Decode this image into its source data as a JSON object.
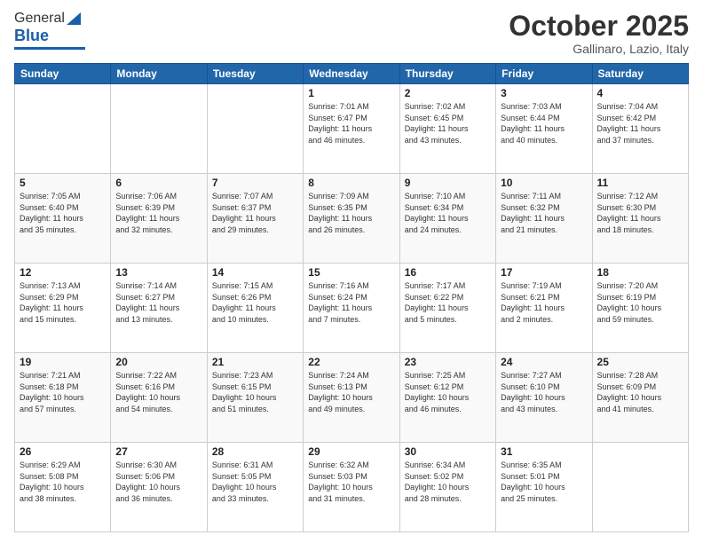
{
  "logo": {
    "general": "General",
    "blue": "Blue"
  },
  "title": {
    "month": "October 2025",
    "location": "Gallinaro, Lazio, Italy"
  },
  "headers": [
    "Sunday",
    "Monday",
    "Tuesday",
    "Wednesday",
    "Thursday",
    "Friday",
    "Saturday"
  ],
  "weeks": [
    [
      {
        "day": "",
        "info": ""
      },
      {
        "day": "",
        "info": ""
      },
      {
        "day": "",
        "info": ""
      },
      {
        "day": "1",
        "info": "Sunrise: 7:01 AM\nSunset: 6:47 PM\nDaylight: 11 hours\nand 46 minutes."
      },
      {
        "day": "2",
        "info": "Sunrise: 7:02 AM\nSunset: 6:45 PM\nDaylight: 11 hours\nand 43 minutes."
      },
      {
        "day": "3",
        "info": "Sunrise: 7:03 AM\nSunset: 6:44 PM\nDaylight: 11 hours\nand 40 minutes."
      },
      {
        "day": "4",
        "info": "Sunrise: 7:04 AM\nSunset: 6:42 PM\nDaylight: 11 hours\nand 37 minutes."
      }
    ],
    [
      {
        "day": "5",
        "info": "Sunrise: 7:05 AM\nSunset: 6:40 PM\nDaylight: 11 hours\nand 35 minutes."
      },
      {
        "day": "6",
        "info": "Sunrise: 7:06 AM\nSunset: 6:39 PM\nDaylight: 11 hours\nand 32 minutes."
      },
      {
        "day": "7",
        "info": "Sunrise: 7:07 AM\nSunset: 6:37 PM\nDaylight: 11 hours\nand 29 minutes."
      },
      {
        "day": "8",
        "info": "Sunrise: 7:09 AM\nSunset: 6:35 PM\nDaylight: 11 hours\nand 26 minutes."
      },
      {
        "day": "9",
        "info": "Sunrise: 7:10 AM\nSunset: 6:34 PM\nDaylight: 11 hours\nand 24 minutes."
      },
      {
        "day": "10",
        "info": "Sunrise: 7:11 AM\nSunset: 6:32 PM\nDaylight: 11 hours\nand 21 minutes."
      },
      {
        "day": "11",
        "info": "Sunrise: 7:12 AM\nSunset: 6:30 PM\nDaylight: 11 hours\nand 18 minutes."
      }
    ],
    [
      {
        "day": "12",
        "info": "Sunrise: 7:13 AM\nSunset: 6:29 PM\nDaylight: 11 hours\nand 15 minutes."
      },
      {
        "day": "13",
        "info": "Sunrise: 7:14 AM\nSunset: 6:27 PM\nDaylight: 11 hours\nand 13 minutes."
      },
      {
        "day": "14",
        "info": "Sunrise: 7:15 AM\nSunset: 6:26 PM\nDaylight: 11 hours\nand 10 minutes."
      },
      {
        "day": "15",
        "info": "Sunrise: 7:16 AM\nSunset: 6:24 PM\nDaylight: 11 hours\nand 7 minutes."
      },
      {
        "day": "16",
        "info": "Sunrise: 7:17 AM\nSunset: 6:22 PM\nDaylight: 11 hours\nand 5 minutes."
      },
      {
        "day": "17",
        "info": "Sunrise: 7:19 AM\nSunset: 6:21 PM\nDaylight: 11 hours\nand 2 minutes."
      },
      {
        "day": "18",
        "info": "Sunrise: 7:20 AM\nSunset: 6:19 PM\nDaylight: 10 hours\nand 59 minutes."
      }
    ],
    [
      {
        "day": "19",
        "info": "Sunrise: 7:21 AM\nSunset: 6:18 PM\nDaylight: 10 hours\nand 57 minutes."
      },
      {
        "day": "20",
        "info": "Sunrise: 7:22 AM\nSunset: 6:16 PM\nDaylight: 10 hours\nand 54 minutes."
      },
      {
        "day": "21",
        "info": "Sunrise: 7:23 AM\nSunset: 6:15 PM\nDaylight: 10 hours\nand 51 minutes."
      },
      {
        "day": "22",
        "info": "Sunrise: 7:24 AM\nSunset: 6:13 PM\nDaylight: 10 hours\nand 49 minutes."
      },
      {
        "day": "23",
        "info": "Sunrise: 7:25 AM\nSunset: 6:12 PM\nDaylight: 10 hours\nand 46 minutes."
      },
      {
        "day": "24",
        "info": "Sunrise: 7:27 AM\nSunset: 6:10 PM\nDaylight: 10 hours\nand 43 minutes."
      },
      {
        "day": "25",
        "info": "Sunrise: 7:28 AM\nSunset: 6:09 PM\nDaylight: 10 hours\nand 41 minutes."
      }
    ],
    [
      {
        "day": "26",
        "info": "Sunrise: 6:29 AM\nSunset: 5:08 PM\nDaylight: 10 hours\nand 38 minutes."
      },
      {
        "day": "27",
        "info": "Sunrise: 6:30 AM\nSunset: 5:06 PM\nDaylight: 10 hours\nand 36 minutes."
      },
      {
        "day": "28",
        "info": "Sunrise: 6:31 AM\nSunset: 5:05 PM\nDaylight: 10 hours\nand 33 minutes."
      },
      {
        "day": "29",
        "info": "Sunrise: 6:32 AM\nSunset: 5:03 PM\nDaylight: 10 hours\nand 31 minutes."
      },
      {
        "day": "30",
        "info": "Sunrise: 6:34 AM\nSunset: 5:02 PM\nDaylight: 10 hours\nand 28 minutes."
      },
      {
        "day": "31",
        "info": "Sunrise: 6:35 AM\nSunset: 5:01 PM\nDaylight: 10 hours\nand 25 minutes."
      },
      {
        "day": "",
        "info": ""
      }
    ]
  ]
}
